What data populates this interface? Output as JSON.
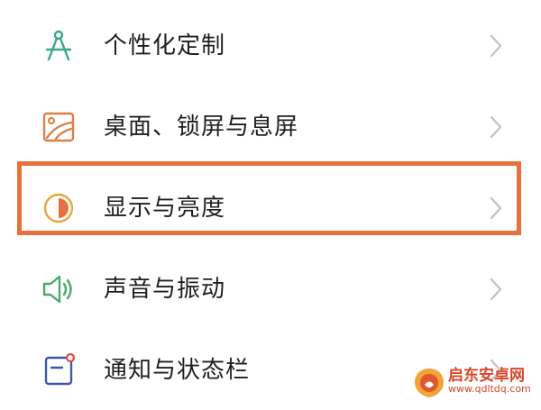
{
  "settings": {
    "items": [
      {
        "label": "个性化定制",
        "icon": "compass-icon"
      },
      {
        "label": "桌面、锁屏与息屏",
        "icon": "wallpaper-icon"
      },
      {
        "label": "显示与亮度",
        "icon": "brightness-icon"
      },
      {
        "label": "声音与振动",
        "icon": "speaker-icon"
      },
      {
        "label": "通知与状态栏",
        "icon": "notification-icon"
      }
    ],
    "highlighted_item": "显示与亮度"
  },
  "watermark": {
    "title": "启东安卓网",
    "url": "www.qdltdq.com"
  },
  "colors": {
    "highlight_border": "#e8703a",
    "chevron": "#c4c4c4",
    "text": "#1f1f1f",
    "watermark": "#d9472b"
  }
}
